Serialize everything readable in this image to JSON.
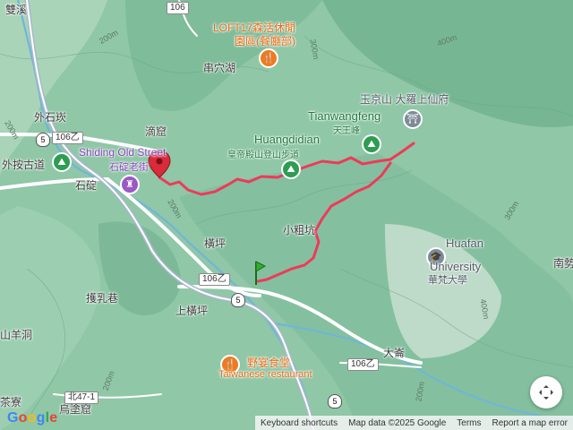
{
  "labels": {
    "shuangxi": "雙溪",
    "waishikeng": "外石崁",
    "waiantrail": "外按古道",
    "shiding_en": "Shiding Old Street",
    "shiding_zh": "石碇老街",
    "shiding": "石碇",
    "diku": "滴窟",
    "chuanxuhu": "串穴湖",
    "hengping": "橫坪",
    "xiaocuokeng": "小粗坑",
    "zhaoruxiang": "擭乳巷",
    "shanghengping": "上橫坪",
    "yangdong": "山羊洞",
    "dazhai": "大崙",
    "nanxing": "南勢",
    "wutuku": "烏塗窟",
    "xiaoliao": "茶寮"
  },
  "pois": {
    "loft_line1": "LOFT17森活休閒",
    "loft_line2": "園區(餐廳部)",
    "huangdi_en": "Huangdidian",
    "huangdi_zh": "皇帝殿山登山步道",
    "tianwang_en": "Tianwangfeng",
    "tianwang_zh": "天王峰",
    "yujing": "玉京山 大羅上仙府",
    "huafan_en1": "Huafan",
    "huafan_en2": "University",
    "huafan_zh": "華梵大學",
    "yeyan_zh": "野宴食堂",
    "yeyan_en": "Taiwanese restaurant"
  },
  "roads": {
    "r106_top": "106",
    "r106b_1": "106乙",
    "r106b_2": "106乙",
    "r106b_3": "106乙",
    "r47_1": "北47-1",
    "hw5_a": "5",
    "hw5_b": "5",
    "hw5_c": "5"
  },
  "contours": {
    "c1": "200m",
    "c2": "200m",
    "c3": "300m",
    "c4": "200m",
    "c5": "400m",
    "c6": "400m",
    "c7": "300m",
    "c8": "200m",
    "c9": "200m"
  },
  "footer": {
    "logo": "Google",
    "shortcuts": "Keyboard shortcuts",
    "mapdata": "Map data ©2025 Google",
    "terms": "Terms",
    "report": "Report a map error"
  },
  "colors": {
    "terrain": "#8fc7a7",
    "route": "#ee3a5a",
    "road_main": "#a9b8c9",
    "river": "#6fb6d8"
  }
}
